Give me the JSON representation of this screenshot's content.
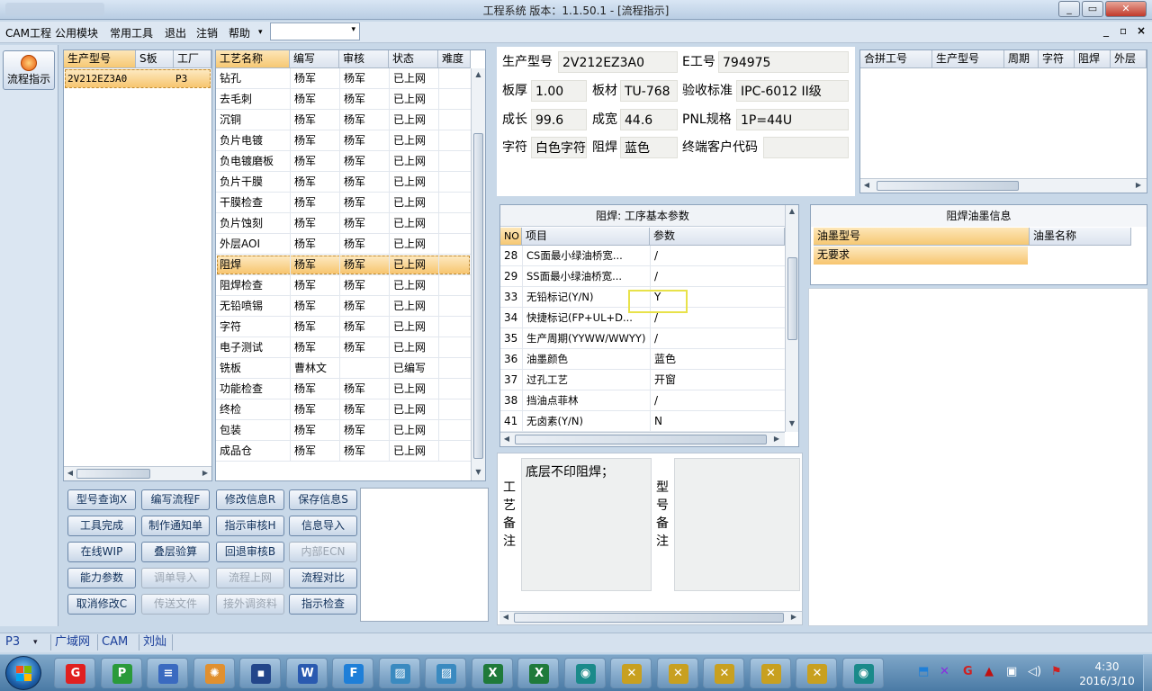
{
  "window": {
    "title": "工程系统  版本：1.1.50.1 - [流程指示]"
  },
  "menu": {
    "items": [
      "CAM工程",
      "公用模块",
      "常用工具",
      "退出",
      "注销",
      "帮助"
    ],
    "help_arrow": "▾",
    "mdi_close": "×",
    "mdi_restore": "▫",
    "mdi_min": "_"
  },
  "nav": {
    "flow_label": "流程指示"
  },
  "product_list": {
    "headers": [
      "生产型号",
      "S板",
      "工厂"
    ],
    "rows": [
      {
        "model": "2V212EZ3A0",
        "s": "",
        "factory": "P3"
      }
    ]
  },
  "process": {
    "headers": [
      "工艺名称",
      "编写",
      "审核",
      "状态",
      "难度"
    ],
    "rows": [
      [
        "钻孔",
        "杨军",
        "杨军",
        "已上网",
        ""
      ],
      [
        "去毛刺",
        "杨军",
        "杨军",
        "已上网",
        ""
      ],
      [
        "沉铜",
        "杨军",
        "杨军",
        "已上网",
        ""
      ],
      [
        "负片电镀",
        "杨军",
        "杨军",
        "已上网",
        ""
      ],
      [
        "负电镀磨板",
        "杨军",
        "杨军",
        "已上网",
        ""
      ],
      [
        "负片干膜",
        "杨军",
        "杨军",
        "已上网",
        ""
      ],
      [
        "干膜检查",
        "杨军",
        "杨军",
        "已上网",
        ""
      ],
      [
        "负片蚀刻",
        "杨军",
        "杨军",
        "已上网",
        ""
      ],
      [
        "外层AOI",
        "杨军",
        "杨军",
        "已上网",
        ""
      ],
      [
        "阻焊",
        "杨军",
        "杨军",
        "已上网",
        ""
      ],
      [
        "阻焊检查",
        "杨军",
        "杨军",
        "已上网",
        ""
      ],
      [
        "无铅喷锡",
        "杨军",
        "杨军",
        "已上网",
        ""
      ],
      [
        "字符",
        "杨军",
        "杨军",
        "已上网",
        ""
      ],
      [
        "电子测试",
        "杨军",
        "杨军",
        "已上网",
        ""
      ],
      [
        "铣板",
        "曹林文",
        "",
        "已编写",
        ""
      ],
      [
        "功能检查",
        "杨军",
        "杨军",
        "已上网",
        ""
      ],
      [
        "终检",
        "杨军",
        "杨军",
        "已上网",
        ""
      ],
      [
        "包装",
        "杨军",
        "杨军",
        "已上网",
        ""
      ],
      [
        "成品仓",
        "杨军",
        "杨军",
        "已上网",
        ""
      ]
    ]
  },
  "buttons": [
    [
      "型号查询X",
      "编写流程F",
      "修改信息R",
      "保存信息S"
    ],
    [
      "工具完成",
      "制作通知单",
      "指示审核H",
      "信息导入"
    ],
    [
      "在线WIP",
      "叠层验算",
      "回退审核B",
      "内部ECN"
    ],
    [
      "能力参数",
      "调单导入",
      "流程上网",
      "流程对比"
    ],
    [
      "取消修改C",
      "传送文件",
      "接外调资料",
      "指示检查"
    ]
  ],
  "disabled_buttons": [
    "内部ECN",
    "调单导入",
    "流程上网",
    "传送文件",
    "接外调资料"
  ],
  "info": {
    "model_label": "生产型号",
    "model": "2V212EZ3A0",
    "e_label": "E工号",
    "e": "794975",
    "thick_label": "板厚",
    "thick": "1.00",
    "mat_label": "板材",
    "mat": "TU-768",
    "std_label": "验收标准",
    "std": "IPC-6012 II级",
    "len_label": "成长",
    "len": "99.6",
    "wid_label": "成宽",
    "wid": "44.6",
    "pnl_label": "PNL规格",
    "pnl": "1P=44U",
    "char_label": "字符",
    "char": "白色字符",
    "mask_label": "阻焊",
    "mask": "蓝色",
    "cust_label": "终端客户代码",
    "cust": ""
  },
  "combine": {
    "headers": [
      "合拼工号",
      "生产型号",
      "周期",
      "字符",
      "阻焊",
      "外层"
    ]
  },
  "params": {
    "title": "阻焊: 工序基本参数",
    "headers": [
      "NO",
      "项目",
      "参数"
    ],
    "rows": [
      [
        "28",
        "CS面最小绿油桥宽...",
        "/"
      ],
      [
        "29",
        "SS面最小绿油桥宽...",
        "/"
      ],
      [
        "33",
        "无铅标记(Y/N)",
        "Y"
      ],
      [
        "34",
        "快捷标记(FP+UL+D...",
        "/"
      ],
      [
        "35",
        "生产周期(YYWW/WWYY)",
        "/"
      ],
      [
        "36",
        "油墨颜色",
        "蓝色"
      ],
      [
        "37",
        "过孔工艺",
        "开窗"
      ],
      [
        "38",
        "挡油点菲林",
        "/"
      ],
      [
        "41",
        "无卤素(Y/N)",
        "N"
      ]
    ]
  },
  "ink": {
    "title": "阻焊油墨信息",
    "headers": [
      "油墨型号",
      "油墨名称"
    ],
    "rows": [
      [
        "无要求",
        ""
      ]
    ]
  },
  "notes": {
    "craft_label": "工\n艺\n备\n注",
    "craft_text": "底层不印阻焊；",
    "model_label": "型\n号\n备\n注",
    "model_text": ""
  },
  "status": {
    "factory": "P3",
    "net": "广域网",
    "dept": "CAM",
    "user": "刘灿"
  },
  "taskbar": {
    "time": "4:30",
    "date": "2016/3/10"
  },
  "colors": {
    "selected_row": "#f7c56f",
    "highlight_box": "#e8e24a",
    "window_bg": "#c8d8e8"
  }
}
